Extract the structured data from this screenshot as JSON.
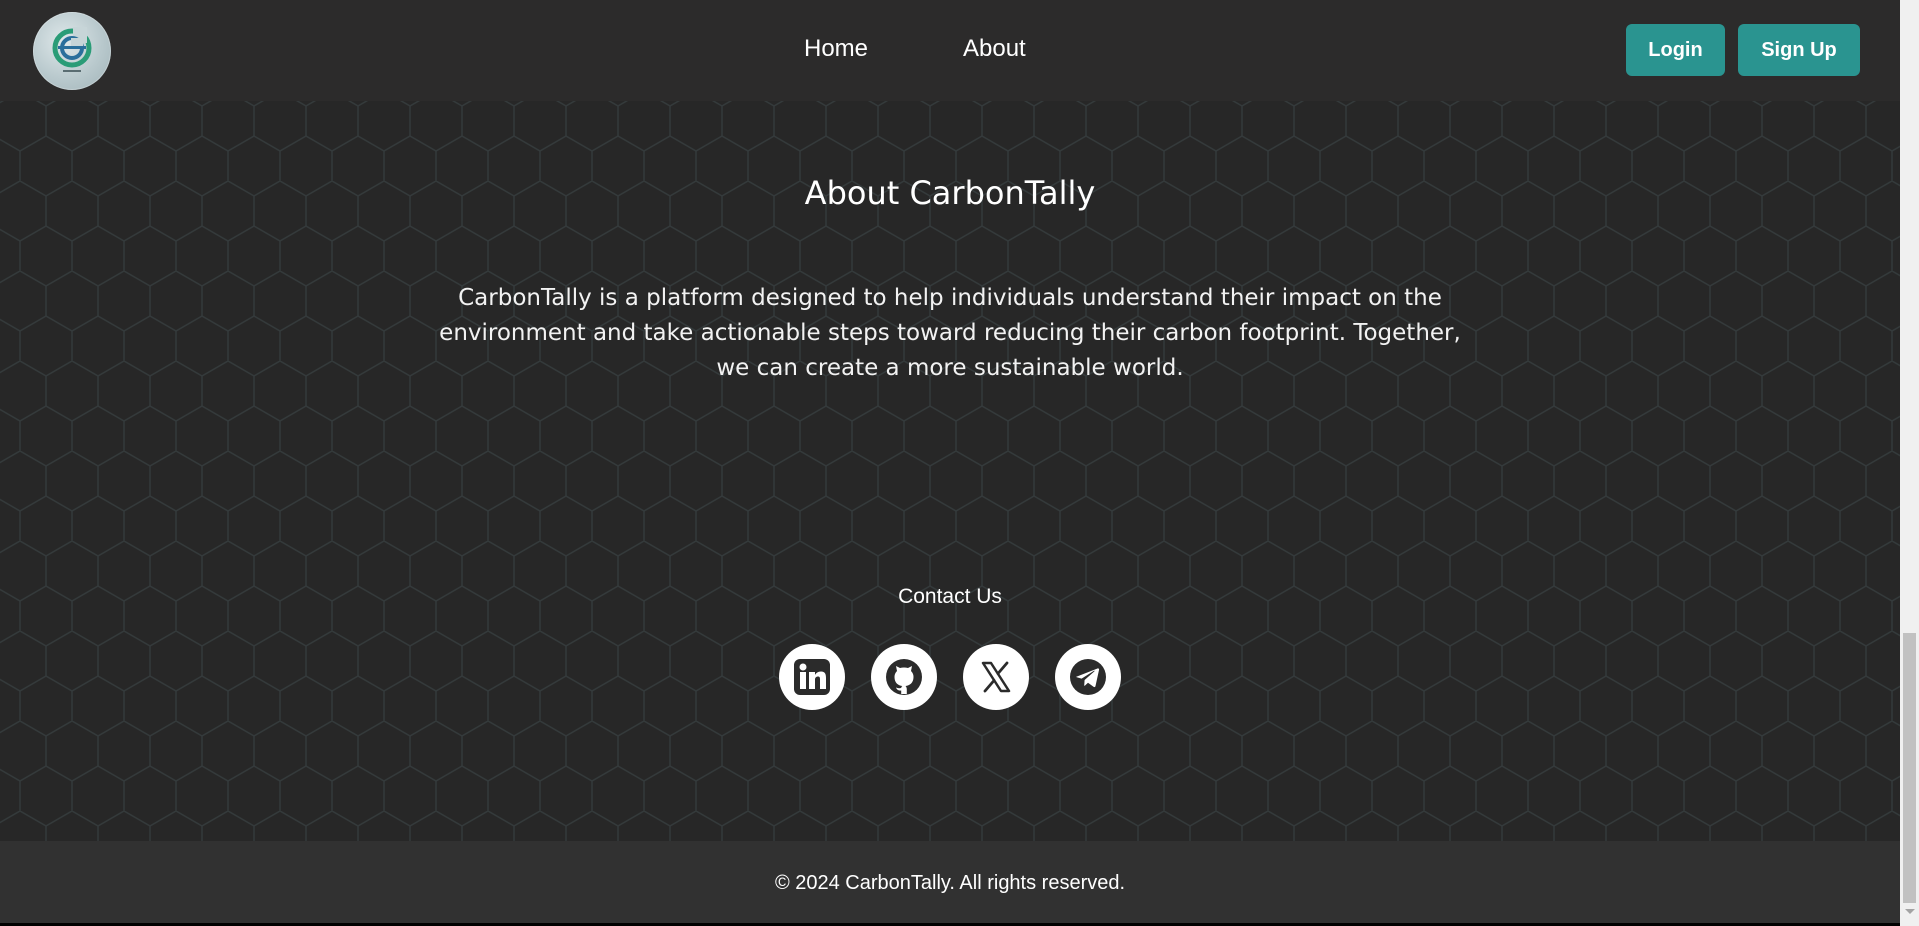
{
  "header": {
    "logo_icon": "carbontally-logo",
    "nav": {
      "home": "Home",
      "about": "About"
    },
    "login_label": "Login",
    "signup_label": "Sign Up"
  },
  "about": {
    "title": "About CarbonTally",
    "paragraph": "CarbonTally is a platform designed to help individuals understand their impact on the environment and take actionable steps toward reducing their carbon footprint. Together, we can create a more sustainable world."
  },
  "contact": {
    "title": "Contact Us",
    "socials": [
      "linkedin-icon",
      "github-icon",
      "x-icon",
      "telegram-icon"
    ]
  },
  "footer": {
    "copyright": "© 2024 CarbonTally. All rights reserved."
  },
  "colors": {
    "header_bg": "#2c2b2b",
    "main_bg": "#272727",
    "accent": "#2a9490",
    "footer_bg": "#313131"
  }
}
